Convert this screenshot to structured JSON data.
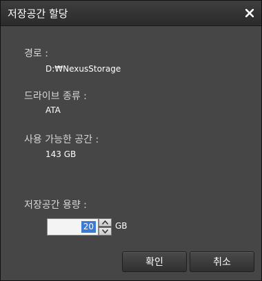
{
  "dialog": {
    "title": "저장공간 할당",
    "close_icon": "close-icon"
  },
  "info": {
    "path_label": "경로 :",
    "path_value": "D:₩NexusStorage",
    "drive_type_label": "드라이브 종류 :",
    "drive_type_value": "ATA",
    "available_label": "사용 가능한 공간 :",
    "available_value": "143 GB"
  },
  "capacity": {
    "label": "저장공간 용량 :",
    "value": "20",
    "unit": "GB"
  },
  "buttons": {
    "ok": "확인",
    "cancel": "취소"
  },
  "colors": {
    "background": "#464646",
    "titlebar": "#2f2f2f",
    "selection": "#3b7bd4"
  }
}
